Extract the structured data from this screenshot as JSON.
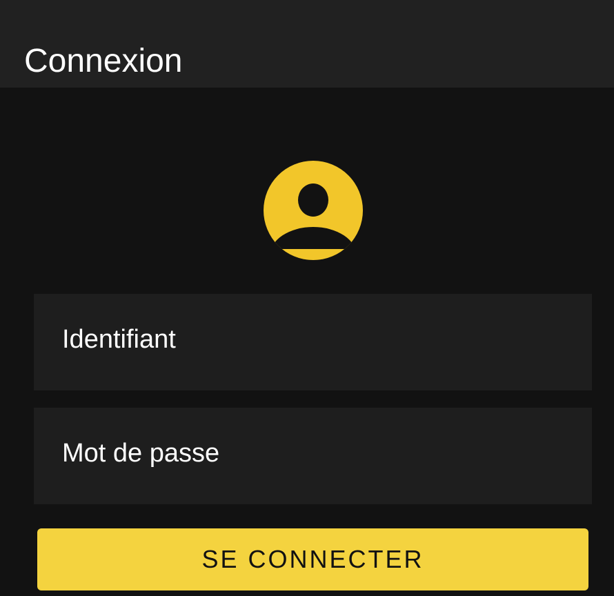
{
  "header": {
    "title": "Connexion"
  },
  "avatar": {
    "icon": "account-circle-icon",
    "color": "#f2c62a"
  },
  "form": {
    "username": {
      "placeholder": "Identifiant",
      "value": ""
    },
    "password": {
      "placeholder": "Mot de passe",
      "value": ""
    },
    "submit_label": "SE CONNECTER"
  },
  "theme": {
    "background": "#121212",
    "header_background": "#212121",
    "field_background": "#1e1e1e",
    "accent": "#f4d33f",
    "text": "#ffffff"
  }
}
